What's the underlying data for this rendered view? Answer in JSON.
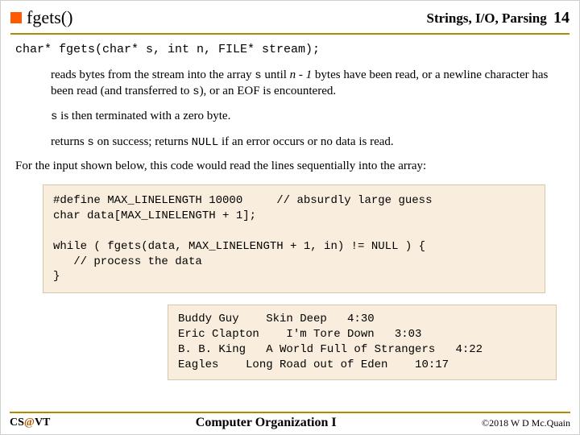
{
  "header": {
    "title": "fgets()",
    "section": "Strings, I/O, Parsing",
    "page": "14"
  },
  "signature": "char* fgets(char* s, int n, FILE* stream);",
  "desc": {
    "p1_a": "reads bytes from the stream into the array ",
    "p1_s1": "s",
    "p1_b": " until ",
    "p1_n1": "n - 1",
    "p1_c": " bytes have been read, or a newline character has been read (and transferred to ",
    "p1_s2": "s",
    "p1_d": "), or an EOF is encountered.",
    "p2_s": "s",
    "p2_a": " is then terminated with a zero byte.",
    "p3_a": "returns ",
    "p3_s": "s",
    "p3_b": " on success; returns ",
    "p3_null": "NULL",
    "p3_c": " if an error occurs or no data is read."
  },
  "lead": "For the input shown below, this code would read the lines sequentially into the array:",
  "code": "#define MAX_LINELENGTH 10000     // absurdly large guess\nchar data[MAX_LINELENGTH + 1];\n\nwhile ( fgets(data, MAX_LINELENGTH + 1, in) != NULL ) {\n   // process the data\n}",
  "output": "Buddy Guy    Skin Deep   4:30\nEric Clapton    I'm Tore Down   3:03\nB. B. King   A World Full of Strangers   4:22\nEagles    Long Road out of Eden    10:17",
  "footer": {
    "left_a": "CS",
    "left_at": "@",
    "left_b": "VT",
    "center": "Computer Organization I",
    "right": "©2018 W D Mc.Quain"
  }
}
